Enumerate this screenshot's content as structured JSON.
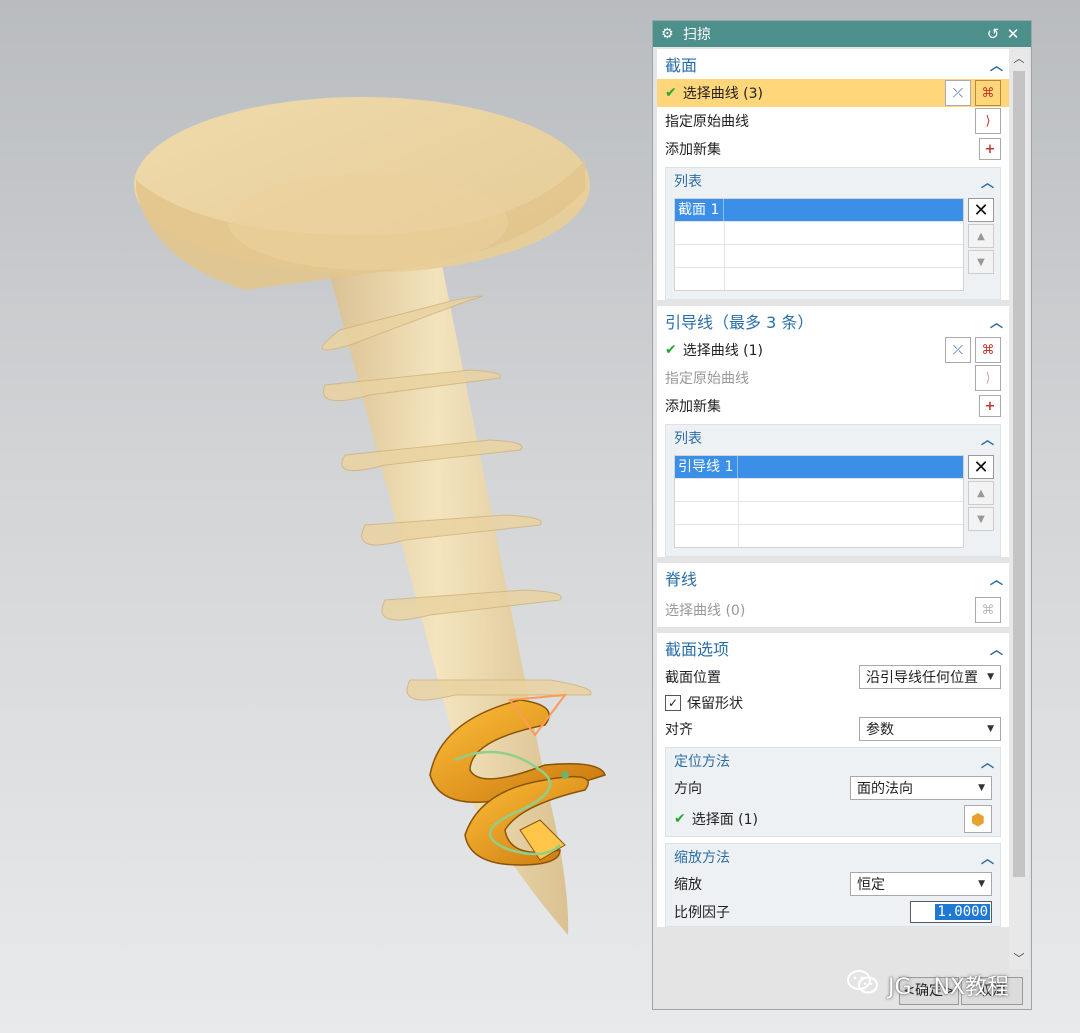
{
  "dialog": {
    "title": "扫掠",
    "title_icon": "gear-icon",
    "section": {
      "title": "截面",
      "select_curve": "选择曲线 (3)",
      "specify_origin": "指定原始曲线",
      "add_new_set": "添加新集",
      "list": {
        "title": "列表",
        "items": [
          "截面 1"
        ]
      }
    },
    "guide": {
      "title": "引导线（最多 3 条）",
      "select_curve": "选择曲线 (1)",
      "specify_origin": "指定原始曲线",
      "add_new_set": "添加新集",
      "list": {
        "title": "列表",
        "items": [
          "引导线 1"
        ]
      }
    },
    "spine": {
      "title": "脊线",
      "select_curve": "选择曲线 (0)"
    },
    "section_options": {
      "title": "截面选项",
      "position_label": "截面位置",
      "position_value": "沿引导线任何位置",
      "keep_shape": "保留形状",
      "align_label": "对齐",
      "align_value": "参数",
      "orientation": {
        "title": "定位方法",
        "direction_label": "方向",
        "direction_value": "面的法向",
        "select_face": "选择面 (1)"
      },
      "scaling": {
        "title": "缩放方法",
        "scale_label": "缩放",
        "scale_value": "恒定",
        "factor_label": "比例因子",
        "factor_value": "1.0000"
      }
    },
    "footer": {
      "ok": "<确定>",
      "cancel": "取消"
    }
  },
  "watermark": {
    "text": "JG - NX教程"
  },
  "colors": {
    "titlebar": "#4d8f8b",
    "accent": "#2b6ea7",
    "highlight": "#ffd77a",
    "selection": "#3b8fe6",
    "screw": "#f0d9a4",
    "sweep": "#f2a11a"
  }
}
